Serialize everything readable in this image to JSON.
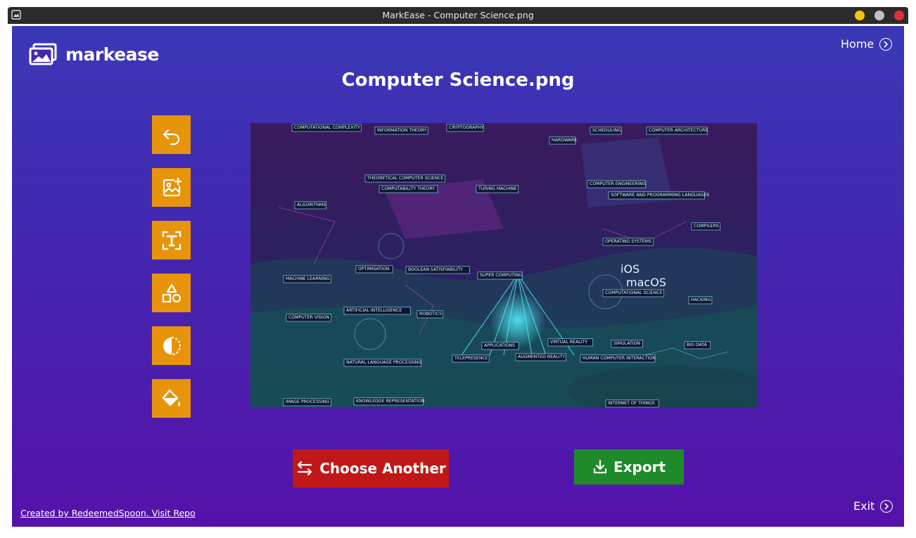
{
  "window": {
    "title": "MarkEase - Computer Science.png"
  },
  "app": {
    "logo_text": "markease",
    "home_label": "Home",
    "exit_label": "Exit",
    "image_title": "Computer Science.png",
    "credit_link": "Created by RedeemedSpoon. Visit Repo"
  },
  "tools": [
    {
      "icon": "undo-icon"
    },
    {
      "icon": "add-image-icon"
    },
    {
      "icon": "text-icon"
    },
    {
      "icon": "shapes-icon"
    },
    {
      "icon": "contrast-icon"
    },
    {
      "icon": "color-fill-icon"
    }
  ],
  "buttons": {
    "choose_another": "Choose Another",
    "export": "Export"
  },
  "preview": {
    "labels": [
      "COMPUTATIONAL COMPLEXITY",
      "INFORMATION THEORY",
      "CRYPTOGRAPHY",
      "HARDWARE",
      "SCHEDULING",
      "COMPUTER ARCHITECTURE",
      "THEORETICAL COMPUTER SCIENCE",
      "COMPUTABILITY THEORY",
      "TURING MACHINE",
      "COMPUTER ENGINEERING",
      "SOFTWARE AND PROGRAMMING LANGUAGES",
      "ALGORITHMS",
      "OPERATING SYSTEMS",
      "COMPILERS",
      "MACHINE LEARNING",
      "OPTIMISATION",
      "BOOLEAN SATISFIABILITY",
      "SUPER COMPUTING",
      "COMPUTATIONAL SCIENCE",
      "HACKING",
      "ARTIFICIAL INTELLIGENCE",
      "ROBOTICS",
      "COMPUTER VISION",
      "APPLICATIONS",
      "VIRTUAL REALITY",
      "SIMULATION",
      "BIG DATA",
      "NATURAL LANGUAGE PROCESSING",
      "TELEPRESENCE",
      "AUGMENTED REALITY",
      "HUMAN COMPUTER INTERACTION",
      "IMAGE PROCESSING",
      "KNOWLEDGE REPRESENTATION",
      "INTERNET OF THINGS",
      "iOS",
      "macOS"
    ]
  },
  "colors": {
    "tool_bg": "#e8940a",
    "choose_bg": "#c01818",
    "export_bg": "#1f8a2a"
  }
}
